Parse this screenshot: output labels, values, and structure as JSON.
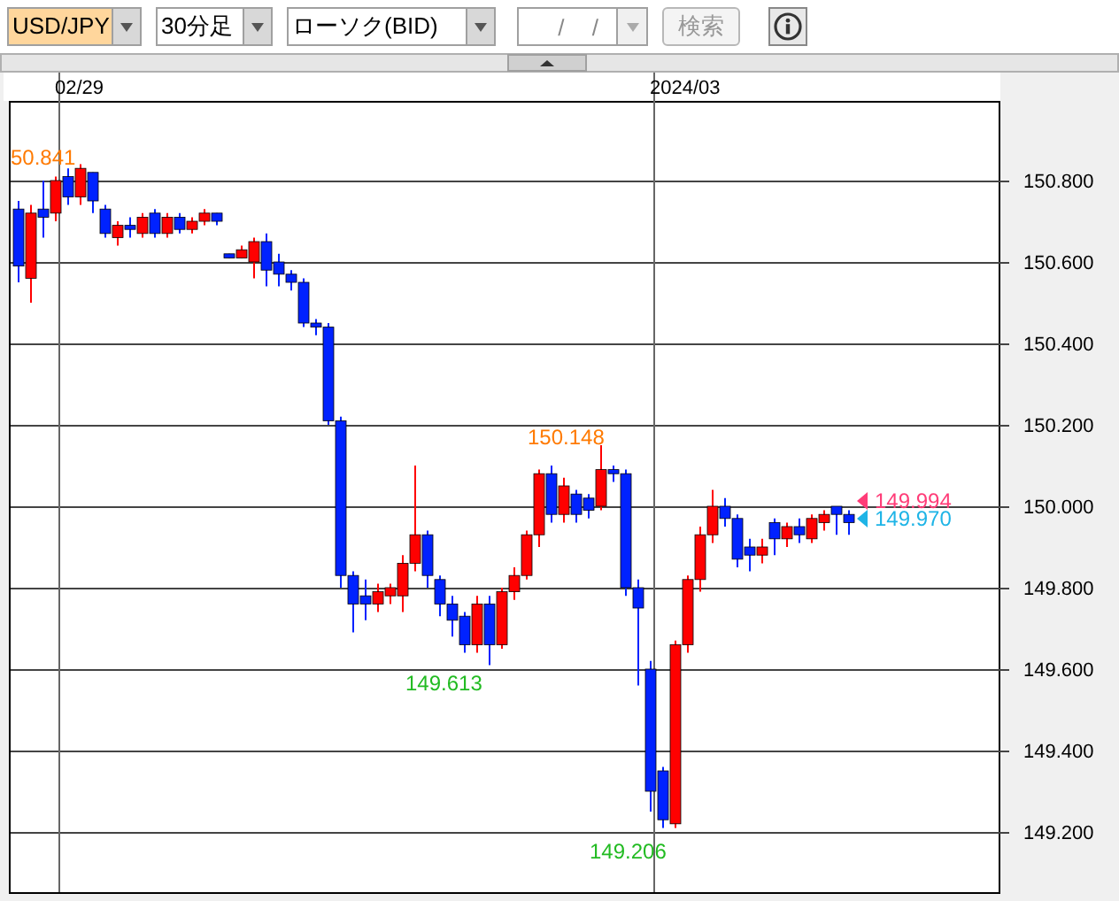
{
  "toolbar": {
    "pair": {
      "value": "USD/JPY",
      "highlighted": true
    },
    "timeframe": {
      "value": "30分足",
      "highlighted": false
    },
    "chart_type": {
      "value": "ローソク(BID)",
      "highlighted": false
    },
    "date": {
      "placeholder": "/ /",
      "disabled": true
    },
    "search_button": {
      "label": "検索",
      "disabled": true
    }
  },
  "chart": {
    "date_labels": [
      "02/29",
      "2024/03"
    ],
    "price_axis": [
      "150.800",
      "150.600",
      "150.400",
      "150.200",
      "150.000",
      "149.800",
      "149.600",
      "149.400",
      "149.200"
    ],
    "annotations": [
      {
        "text": "50.841",
        "color": "#ff7a00"
      },
      {
        "text": "150.148",
        "color": "#ff7a00"
      },
      {
        "text": "149.613",
        "color": "#22bb22"
      },
      {
        "text": "149.206",
        "color": "#22bb22"
      }
    ],
    "current_prices": [
      {
        "text": "149.994",
        "color": "#ff3c78"
      },
      {
        "text": "149.970",
        "color": "#1eb4e6"
      }
    ]
  }
}
